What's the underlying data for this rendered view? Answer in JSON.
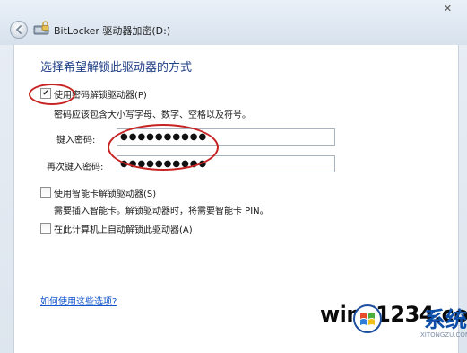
{
  "window": {
    "title": "BitLocker 驱动器加密(D:)",
    "close_glyph": "✕"
  },
  "page": {
    "heading": "选择希望解锁此驱动器的方式"
  },
  "options": {
    "password": {
      "label": "使用密码解锁驱动器(P)",
      "checked": true,
      "hint": "密码应该包含大小写字母、数字、空格以及符号。",
      "enter_label": "键入密码:",
      "enter_value": "●●●●●●●●●●",
      "confirm_label": "再次键入密码:",
      "confirm_value": "●●●●●●●●●●"
    },
    "smartcard": {
      "label": "使用智能卡解锁驱动器(S)",
      "checked": false,
      "hint": "需要插入智能卡。解锁驱动器时，将需要智能卡 PIN。"
    },
    "auto": {
      "label": "在此计算机上自动解锁此驱动器(A)",
      "checked": false
    }
  },
  "help_link": "如何使用这些选项?",
  "watermark": {
    "main": "win71234.com",
    "cn": "系统族",
    "sub": "XITONGZU.COM"
  },
  "colors": {
    "heading": "#1f3f86",
    "link": "#1155cc",
    "annotation": "#c82323"
  }
}
